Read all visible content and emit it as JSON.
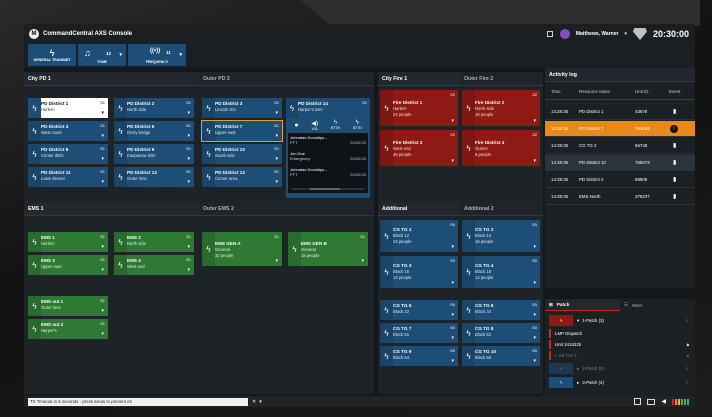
{
  "app": {
    "title": "CommandCentral AXS Console",
    "user": "Matthews, Warner",
    "clock": "20:30:00",
    "logo": "M"
  },
  "toolbar": {
    "buttons": [
      {
        "label": "GENERAL TRANSMIT",
        "icon": "lightning-icon"
      },
      {
        "label": "TONE",
        "value": "12",
        "icon": "music-note-icon"
      },
      {
        "label": "FREQUENCY",
        "value": "11",
        "icon": "frequency-icon"
      }
    ]
  },
  "panels": {
    "city_pd1": "City PD 1",
    "outer_pd2": "Outer PD 2",
    "ems1": "EMS 1",
    "outer_ems2": "Outer EMS 2",
    "city_fire1": "City Fire 1",
    "outer_fire2": "Outer Fire 2",
    "additional": "Additional",
    "additional2": "Additional 2"
  },
  "tiles": {
    "pd1": {
      "name": "PD District 1",
      "sub": "Harlem",
      "num": "S1"
    },
    "pd2": {
      "name": "PD District 2",
      "sub": "North side",
      "num": "S1"
    },
    "pd3": {
      "name": "PD District 3",
      "sub": "Lincoln Sct.",
      "num": "S1"
    },
    "pd4": {
      "name": "PD District 4",
      "sub": "West coast",
      "num": "S1"
    },
    "pd6": {
      "name": "PD District 6",
      "sub": "Gerry bridge",
      "num": "S1"
    },
    "pd7": {
      "name": "PD District 7",
      "sub": "Upper east",
      "num": "S1"
    },
    "pd8": {
      "name": "PD District 8",
      "sub": "Center ditch",
      "num": "S1"
    },
    "pd9": {
      "name": "PD District 9",
      "sub": "Kaspanow tnltn",
      "num": "S1"
    },
    "pd10": {
      "name": "PD District 10",
      "sub": "South side",
      "num": "S1"
    },
    "pd11": {
      "name": "PD District 11",
      "sub": "Lowe denver",
      "num": "S1"
    },
    "pd12": {
      "name": "PD District 12",
      "sub": "Outer rims",
      "num": "S1"
    },
    "pd13": {
      "name": "PD District 13",
      "sub": "Corner area",
      "num": "S1"
    },
    "pd14": {
      "name": "PD District 14",
      "sub": "Harper's Den",
      "num": "S1"
    },
    "ems1": {
      "name": "EMS 1",
      "sub": "Harlem",
      "num": "S1"
    },
    "ems2": {
      "name": "EMS 2",
      "sub": "North side",
      "num": "S1"
    },
    "ems3": {
      "name": "EMS 3",
      "sub": "Upper east",
      "num": "S1"
    },
    "ems4": {
      "name": "EMS 4",
      "sub": "West end",
      "num": "S1"
    },
    "emsgena": {
      "name": "EMS GEN A",
      "sub": "General",
      "sub2": "32 people",
      "num": "S1"
    },
    "emsgenb": {
      "name": "EMS GEN B",
      "sub": "General",
      "sub2": "15 people",
      "num": "S1"
    },
    "emsout1": {
      "name": "EMS out 1",
      "sub": "Outer rims",
      "num": "S1"
    },
    "emsout2": {
      "name": "EMS out 2",
      "sub": "Harper's",
      "num": "S1"
    },
    "fd1": {
      "name": "Fire District 1",
      "sub": "Harlem",
      "sub2": "24 people",
      "num": "S2"
    },
    "fd2": {
      "name": "Fire District 2",
      "sub": "North side",
      "sub2": "16 people",
      "num": "S2"
    },
    "fd3": {
      "name": "Fire District 3",
      "sub": "West end",
      "sub2": "45 people",
      "num": "S2"
    },
    "fd4": {
      "name": "Fire District 4",
      "sub": "Outers",
      "sub2": "6 people",
      "num": "S2"
    },
    "cg1": {
      "name": "CG TG 1",
      "sub": "Block 12",
      "sub2": "23 people",
      "num": "S0"
    },
    "cg2": {
      "name": "CG TG 2",
      "sub": "Block 14",
      "sub2": "15 people",
      "num": "S0"
    },
    "cg3": {
      "name": "CG TG 3",
      "sub": "Block 16",
      "sub2": "14 people",
      "num": "S0"
    },
    "cg4": {
      "name": "CG TG 4",
      "sub": "Block 18",
      "sub2": "12 people",
      "num": "S0"
    },
    "cg5": {
      "name": "CG TG 5",
      "sub": "Block 22",
      "num": "S0"
    },
    "cg6": {
      "name": "CG TG 6",
      "sub": "Block 34",
      "num": "S0"
    },
    "cg7": {
      "name": "CG TG 7",
      "sub": "Block 51",
      "num": "S0"
    },
    "cg8": {
      "name": "CG TG 8",
      "sub": "Block 52",
      "num": "S0"
    },
    "cg9": {
      "name": "CG TG 9",
      "sub": "Block 54",
      "num": "S0"
    },
    "cg10": {
      "name": "CG TG 10",
      "sub": "Block 56",
      "num": "S0"
    }
  },
  "pd14_list": {
    "controls": [
      "VOL",
      "BTTN",
      "BTTN"
    ],
    "entries": [
      {
        "name": "Johnatan Kovaldpu...",
        "role": "PTT",
        "time": "24:22:22"
      },
      {
        "name": "Jon Doe",
        "role": "Emergency",
        "time": "24:22:22"
      },
      {
        "name": "Johnatan Kovaldpu...",
        "role": "PTT",
        "time": "24:22:22"
      }
    ]
  },
  "activity": {
    "title": "Activity log",
    "headers": [
      "Time",
      "Resource name",
      "Unit ID",
      "Event"
    ],
    "rows": [
      {
        "time": "14:28:35",
        "name": "PD District 1",
        "id": "43678",
        "icon": "radio-icon",
        "highlight": false
      },
      {
        "time": "14:28:35",
        "name": "PD District 7",
        "id": "763004",
        "icon": "alert-icon",
        "highlight": true
      },
      {
        "time": "14:28:35",
        "name": "CG TG 2",
        "id": "56748",
        "icon": "radio-icon",
        "highlight": false
      },
      {
        "time": "14:28:35",
        "name": "PD District 10",
        "id": "769273",
        "icon": "radio-icon",
        "highlight": false
      },
      {
        "time": "14:28:35",
        "name": "PD District 2",
        "id": "88909",
        "icon": "radio-icon",
        "highlight": false
      },
      {
        "time": "14:28:35",
        "name": "EMS North",
        "id": "379237",
        "icon": "radio-icon",
        "highlight": false
      }
    ]
  },
  "patch": {
    "tab1": "Patch",
    "tab2": "Mset",
    "items": [
      {
        "label": "1-Patch (3)"
      },
      {
        "label": "LMP Dispatch"
      },
      {
        "label": "Unit 3415325"
      },
      {
        "label": "US TAC 1"
      },
      {
        "label": "2-Patch (0)"
      },
      {
        "label": "3-Patch (2)"
      }
    ]
  },
  "status": {
    "text": "TX Timeout in 5 seconds - press arrow to present int",
    "close": "✕"
  }
}
